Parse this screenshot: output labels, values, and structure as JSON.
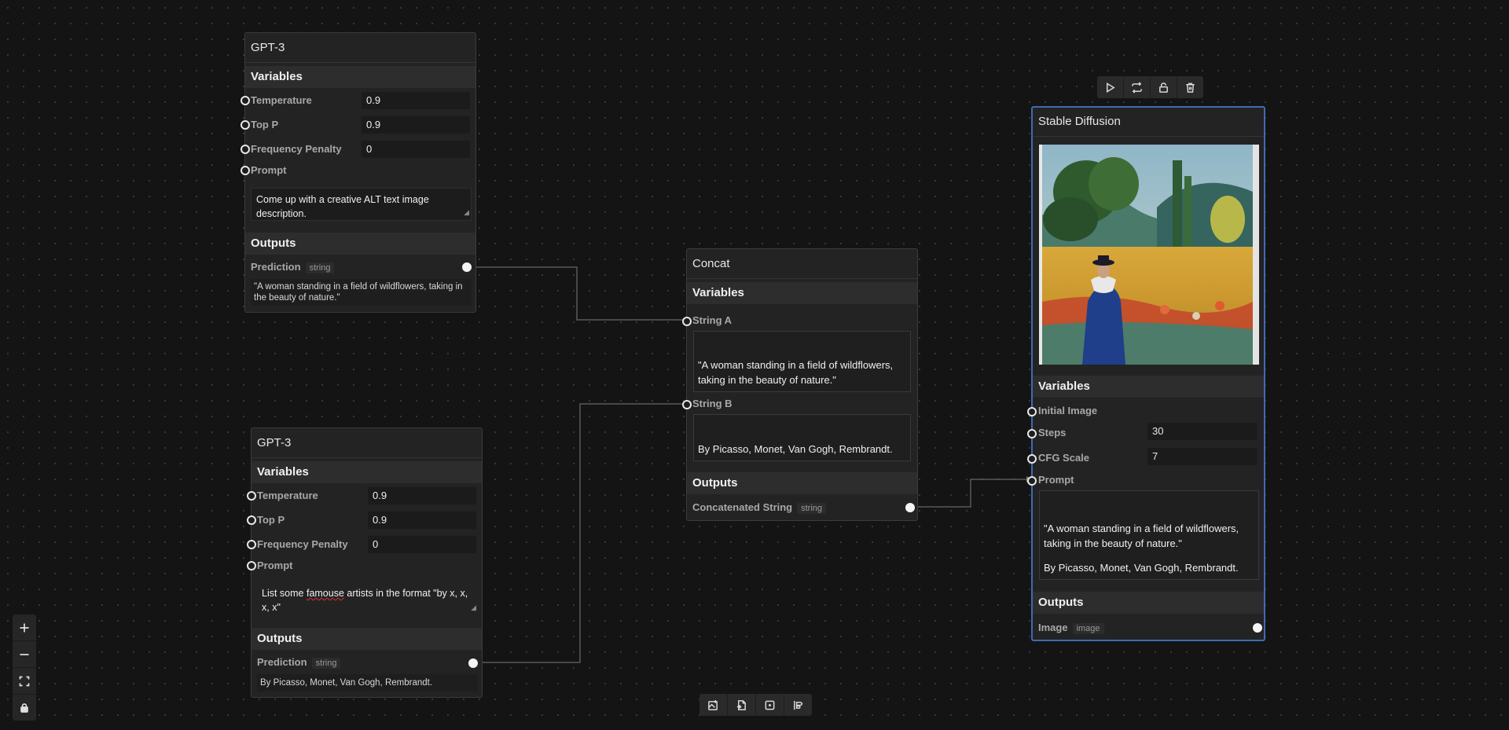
{
  "gpt3_a": {
    "title": "GPT-3",
    "variables_label": "Variables",
    "temperature_label": "Temperature",
    "temperature": "0.9",
    "top_p_label": "Top P",
    "top_p": "0.9",
    "freq_label": "Frequency Penalty",
    "freq": "0",
    "prompt_label": "Prompt",
    "prompt": "Come up with a creative ALT text image description.",
    "outputs_label": "Outputs",
    "prediction_label": "Prediction",
    "prediction_type": "string",
    "prediction": "\"A woman standing in a field of wildflowers, taking in the beauty of nature.\""
  },
  "gpt3_b": {
    "title": "GPT-3",
    "variables_label": "Variables",
    "temperature_label": "Temperature",
    "temperature": "0.9",
    "top_p_label": "Top P",
    "top_p": "0.9",
    "freq_label": "Frequency Penalty",
    "freq": "0",
    "prompt_label": "Prompt",
    "prompt_pre": "List some ",
    "prompt_misspelled": "famouse",
    "prompt_post": " artists in the format \"by x, x, x, x\"",
    "outputs_label": "Outputs",
    "prediction_label": "Prediction",
    "prediction_type": "string",
    "prediction": "By Picasso, Monet, Van Gogh, Rembrandt."
  },
  "concat": {
    "title": "Concat",
    "variables_label": "Variables",
    "string_a_label": "String A",
    "string_a": "\"A woman standing in a field of wildflowers, taking in the beauty of nature.\"",
    "string_b_label": "String B",
    "string_b": "By Picasso, Monet, Van Gogh, Rembrandt.",
    "outputs_label": "Outputs",
    "output_label": "Concatenated String",
    "output_type": "string"
  },
  "sd": {
    "title": "Stable Diffusion",
    "variables_label": "Variables",
    "initial_image_label": "Initial Image",
    "steps_label": "Steps",
    "steps": "30",
    "cfg_label": "CFG Scale",
    "cfg": "7",
    "prompt_label": "Prompt",
    "prompt_line1": "\"A woman standing in a field of wildflowers, taking in the beauty of nature.\"",
    "prompt_line2": "By Picasso, Monet, Van Gogh, Rembrandt.",
    "outputs_label": "Outputs",
    "output_label": "Image",
    "output_type": "image"
  },
  "node_toolbar_icons": [
    "play-icon",
    "repeat-icon",
    "unlock-icon",
    "trash-icon"
  ],
  "zoom_controls_icons": [
    "plus-icon",
    "minus-icon",
    "fit-view-icon",
    "lock-icon"
  ],
  "bottom_toolbar_icons": [
    "add-image-icon",
    "add-file-icon",
    "add-node-icon",
    "align-icon"
  ],
  "colors": {
    "background": "#141414",
    "node": "#232323",
    "selected_border": "#3f6bb3",
    "edge": "#5a5a5a"
  }
}
